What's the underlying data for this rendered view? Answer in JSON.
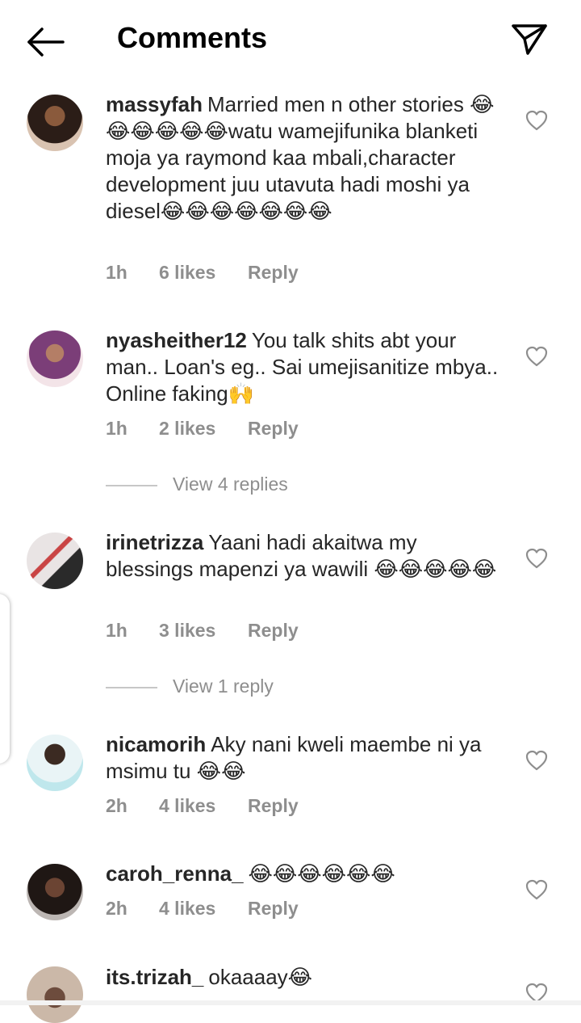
{
  "header": {
    "title": "Comments",
    "back_icon": "arrow-left-icon",
    "share_icon": "paper-plane-icon"
  },
  "comments": [
    {
      "username": "massyfah",
      "text": "Married men n other stories 😂😂😂😂😂😂watu wamejifunika blanketi moja ya raymond kaa mbali,character development juu utavuta hadi moshi ya diesel😂😂😂😂😂😂😂",
      "time": "1h",
      "likes": "6 likes",
      "reply": "Reply"
    },
    {
      "username": "nyasheither12",
      "text": "You talk shits abt your man.. Loan's eg.. Sai umejisanitize mbya.. Online faking🙌",
      "time": "1h",
      "likes": "2 likes",
      "reply": "Reply",
      "view_replies": "View 4 replies"
    },
    {
      "username": "irinetrizza",
      "text": "Yaani hadi akaitwa my blessings mapenzi ya wawili 😂😂😂😂😂",
      "time": "1h",
      "likes": "3 likes",
      "reply": "Reply",
      "view_replies": "View 1 reply"
    },
    {
      "username": "nicamorih",
      "text": "Aky nani kweli maembe ni ya msimu tu 😂😂",
      "time": "2h",
      "likes": "4 likes",
      "reply": "Reply"
    },
    {
      "username": "caroh_renna_",
      "text": "😂😂😂😂😂😂",
      "time": "2h",
      "likes": "4 likes",
      "reply": "Reply"
    },
    {
      "username": "its.trizah_",
      "text": "okaaaay😂"
    }
  ],
  "colors": {
    "text": "#262626",
    "meta": "#8e8e8e"
  }
}
